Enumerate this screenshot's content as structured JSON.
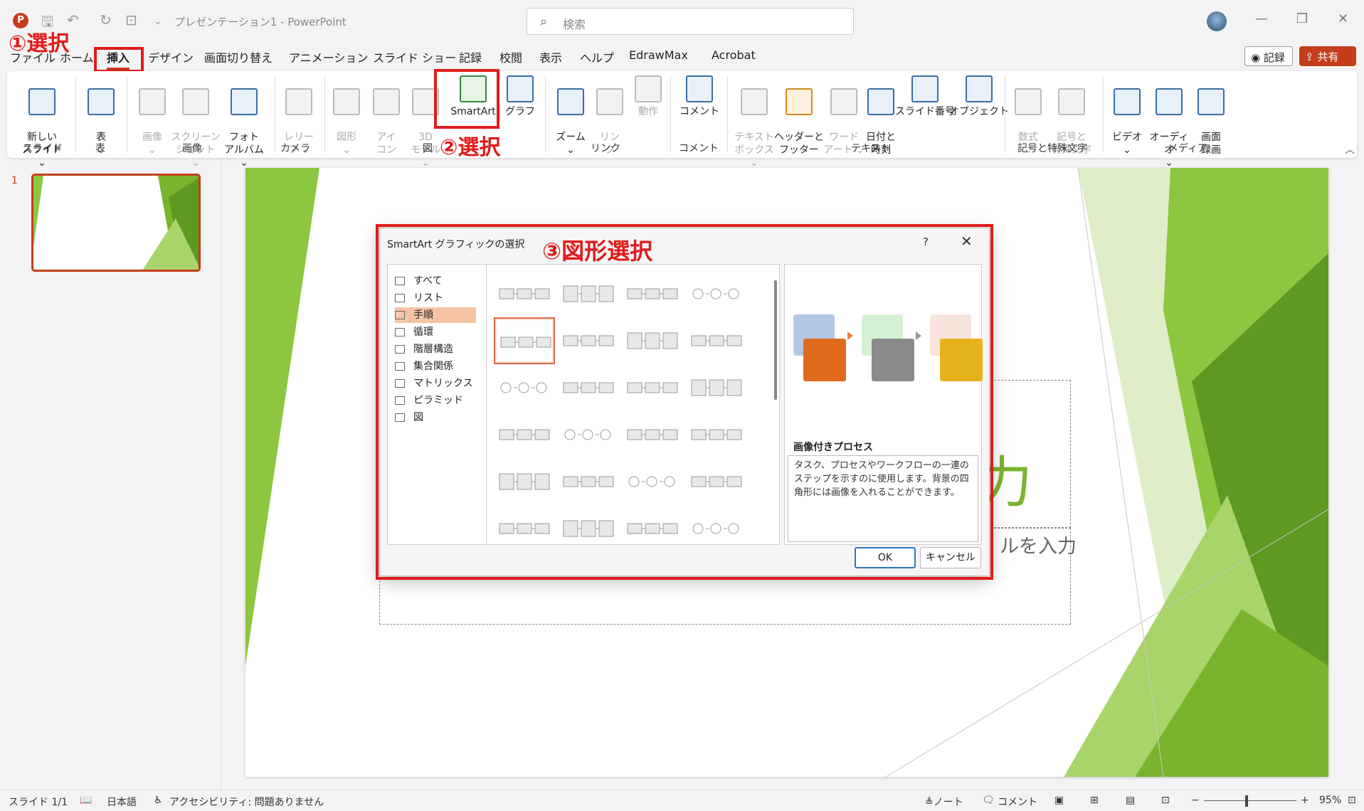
{
  "window": {
    "app_icon": "P",
    "doc_title": "プレゼンテーション1  -  PowerPoint",
    "search_placeholder": "検索",
    "quick_access": [
      "save-icon",
      "undo-icon",
      "redo-icon",
      "customize-icon"
    ]
  },
  "tabs": [
    "ファイル",
    "ホーム",
    "挿入",
    "デザイン",
    "画面切り替え",
    "アニメーション",
    "スライド ショー",
    "記録",
    "校閲",
    "表示",
    "ヘルプ",
    "EdrawMax",
    "Acrobat"
  ],
  "active_tab": "挿入",
  "header_buttons": {
    "record": "◉ 記録",
    "share": "⇪ 共有 ⌄"
  },
  "ribbon": {
    "new_slide": "新しい\nスライド ⌄",
    "table": "表\n⌄",
    "image": "画像\n⌄",
    "screenshot": "スクリーン\nショット ⌄",
    "photo_album": "フォト\nアルバム ⌄",
    "cameo": "レリー\nフ ⌄",
    "shapes": "図形\n⌄",
    "icons": "アイ\nコン",
    "model3d": "3D\nモデル ⌄",
    "smartart": "SmartArt",
    "chart": "グラフ",
    "zoom": "ズーム\n⌄",
    "link": "リン\nク",
    "action": "動作",
    "comment": "コメント",
    "textbox": "テキスト\nボックス ⌄",
    "header_footer": "ヘッダーと\nフッター",
    "wordart": "ワード\nアート ⌄",
    "datetime": "日付と\n時刻",
    "slide_number": "スライド番号",
    "object": "オブジェクト",
    "equation": "数式\n⌄",
    "symbol": "記号と\n特殊文字",
    "video": "ビデオ\n⌄",
    "audio": "オーディオ\n⌄",
    "screen_record": "画面\n録画",
    "groups": {
      "slide": "スライド",
      "table": "表",
      "image": "画像",
      "camera": "カメラ",
      "figure": "図",
      "link": "リンク",
      "comment": "コメント",
      "text": "テキスト",
      "symbols": "記号と特殊文字",
      "media": "メディア"
    }
  },
  "annotations": {
    "step1": "①選択",
    "step2": "②選択",
    "step3": "③図形選択",
    "color": "#e01b1b"
  },
  "slide_panel": {
    "number": "1"
  },
  "slide": {
    "title_fragment": "力",
    "subtitle_fragment": "ルを入力",
    "accent": "#7ab42d"
  },
  "dialog": {
    "title": "SmartArt グラフィックの選択",
    "help": "?",
    "close": "✕",
    "categories": [
      "すべて",
      "リスト",
      "手順",
      "循環",
      "階層構造",
      "集合関係",
      "マトリックス",
      "ピラミッド",
      "図"
    ],
    "selected_category": "手順",
    "preview_name": "画像付きプロセス",
    "preview_description": "タスク、プロセスやワークフローの一連のステップを示すのに使用します。背景の四角形には画像を入れることができます。",
    "ok": "OK",
    "cancel": "キャンセル"
  },
  "statusbar": {
    "slide_info": "スライド 1/1",
    "language": "日本語",
    "accessibility": "アクセシビリティ: 問題ありません",
    "notes": "≜ノート",
    "comments": "コメント",
    "zoom": "95%"
  }
}
